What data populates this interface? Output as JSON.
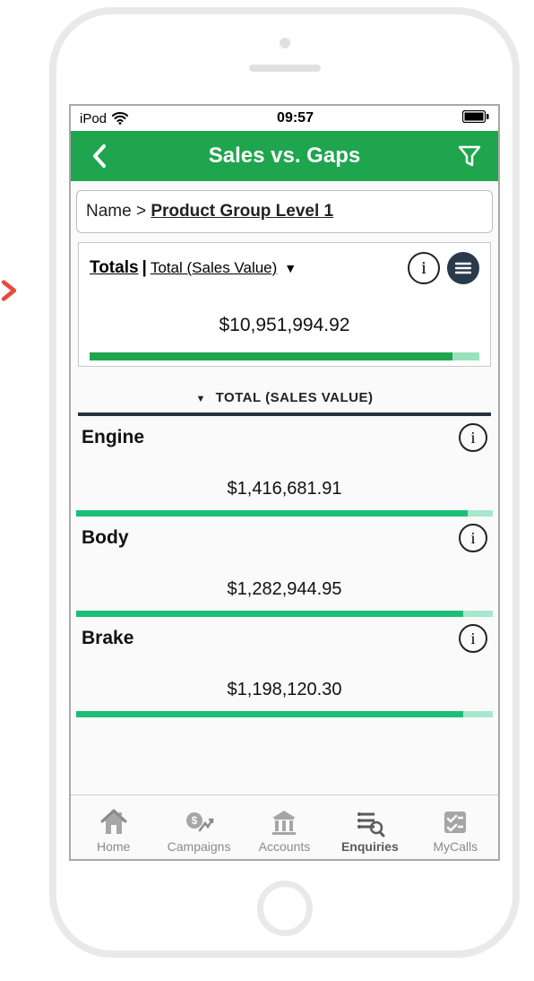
{
  "status": {
    "carrier": "iPod",
    "time": "09:57"
  },
  "nav": {
    "title": "Sales vs. Gaps"
  },
  "breadcrumb": {
    "root": "Name",
    "sep": ">",
    "active": "Product Group Level 1"
  },
  "totals": {
    "label_main": "Totals",
    "label_sep": "|",
    "label_sub": "Total (Sales Value)",
    "value": "$10,951,994.92",
    "bar_pct": 93
  },
  "section_header": "TOTAL (SALES VALUE)",
  "rows": [
    {
      "name": "Engine",
      "value": "$1,416,681.91",
      "bar_pct": 94
    },
    {
      "name": "Body",
      "value": "$1,282,944.95",
      "bar_pct": 93
    },
    {
      "name": "Brake",
      "value": "$1,198,120.30",
      "bar_pct": 93
    }
  ],
  "tabs": [
    {
      "label": "Home"
    },
    {
      "label": "Campaigns"
    },
    {
      "label": "Accounts"
    },
    {
      "label": "Enquiries"
    },
    {
      "label": "MyCalls"
    }
  ]
}
